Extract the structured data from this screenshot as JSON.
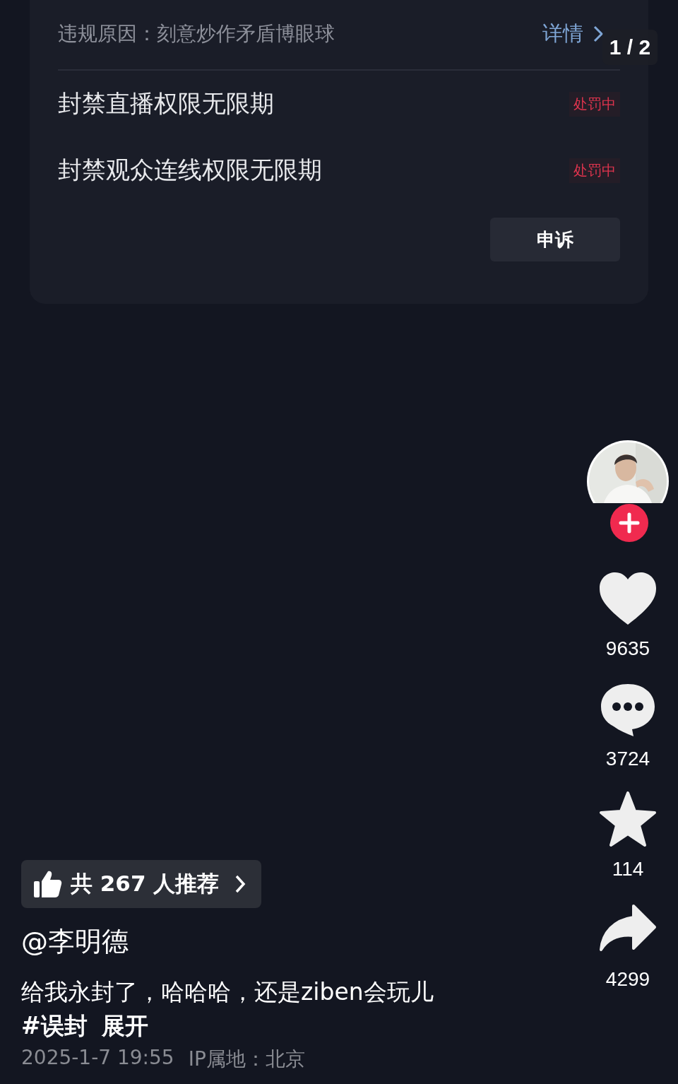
{
  "violation": {
    "reason": "违规原因：刻意炒作矛盾博眼球",
    "details_link": "详情"
  },
  "penalties": [
    {
      "text": "封禁直播权限无限期",
      "status": "处罚中"
    },
    {
      "text": "封禁观众连线权限无限期",
      "status": "处罚中"
    }
  ],
  "appeal_button": "申诉",
  "page_indicator": "1 / 2",
  "actions": [
    {
      "kind": "like",
      "count": "9635"
    },
    {
      "kind": "comment",
      "count": "3724"
    },
    {
      "kind": "favorite",
      "count": "114"
    },
    {
      "kind": "share",
      "count": "4299"
    }
  ],
  "recommend": "共 267 人推荐",
  "author": "@李明德",
  "caption": "给我永封了，哈哈哈，还是ziben会玩儿",
  "hashtag": "#误封",
  "expand": "展开",
  "meta": {
    "time": "2025-1-7 19:55",
    "location": "IP属地：北京"
  }
}
